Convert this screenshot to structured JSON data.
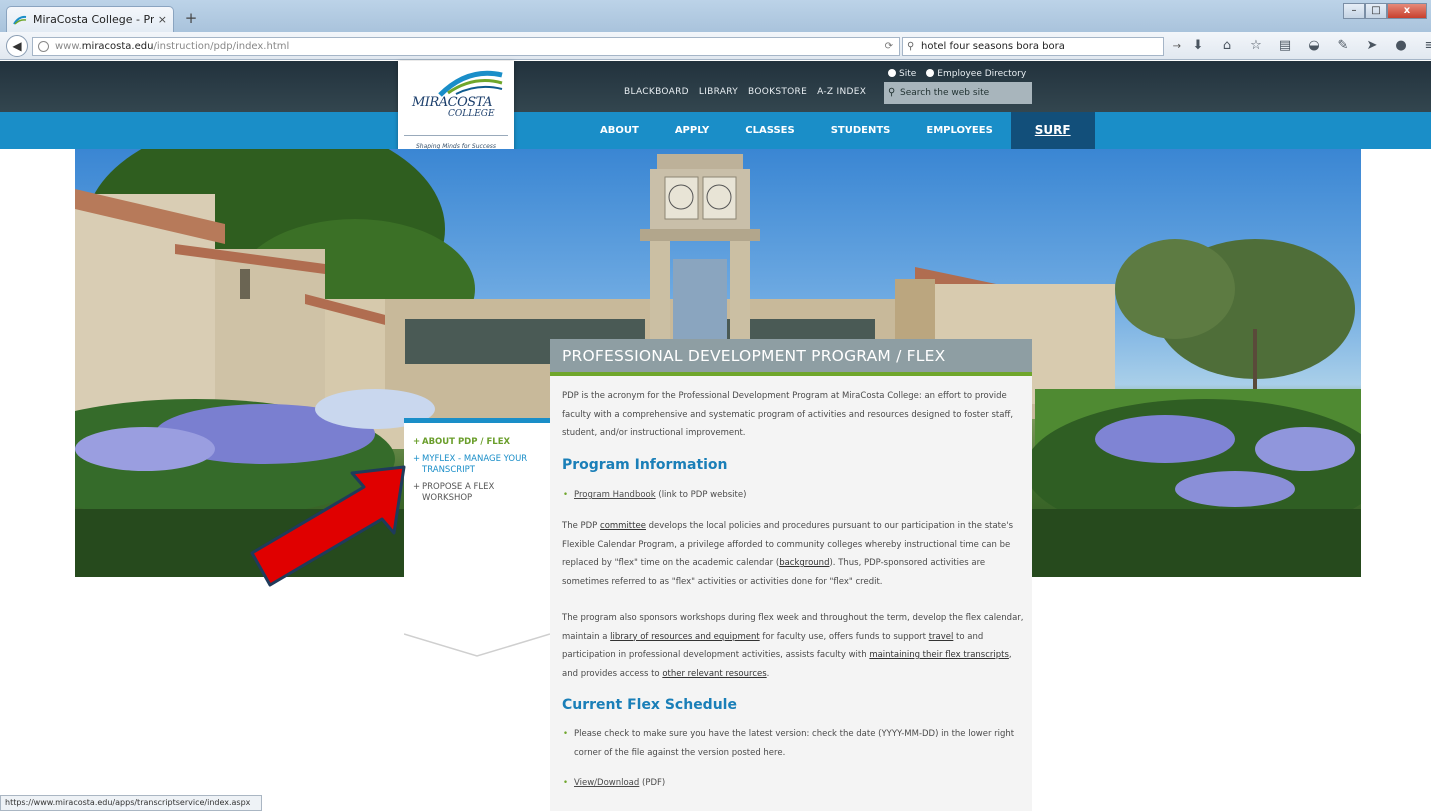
{
  "browser": {
    "tab_title": "MiraCosta College - Profes...",
    "tab_close": "×",
    "new_tab": "+",
    "url_prefix": "www.",
    "url_domain": "miracosta.edu",
    "url_path": "/instruction/pdp/index.html",
    "search_value": "hotel four seasons bora bora",
    "status_url": "https://www.miracosta.edu/apps/transcriptservice/index.aspx",
    "accent_color": "#1a8ec8"
  },
  "site": {
    "logo_name": "MIRACOSTA",
    "logo_sub": "COLLEGE",
    "logo_tagline": "Shaping Minds for Success",
    "utility_links": [
      "BLACKBOARD",
      "LIBRARY",
      "BOOKSTORE",
      "A-Z INDEX"
    ],
    "search_options": [
      "Site",
      "Employee Directory"
    ],
    "search_placeholder": "Search the web site",
    "nav": [
      "ABOUT",
      "APPLY",
      "CLASSES",
      "STUDENTS",
      "EMPLOYEES"
    ],
    "nav_special": "SURF"
  },
  "side_menu": [
    {
      "label": "About PDP / Flex"
    },
    {
      "label": "MyFlex - Manage Your Transcript"
    },
    {
      "label": "Propose A Flex Workshop"
    }
  ],
  "content": {
    "title": "PROFESSIONAL DEVELOPMENT PROGRAM / FLEX",
    "intro": "PDP is the acronym for the Professional Development Program at MiraCosta College: an effort to provide faculty with a comprehensive and systematic program of activities and resources designed to foster staff, student, and/or instructional improvement.",
    "heading_program": "Program Information",
    "handbook_link": "Program Handbook",
    "handbook_note": " (link to PDP website)",
    "p1_a": "The PDP ",
    "p1_committee": "committee",
    "p1_b": " develops the local policies and procedures pursuant to our participation in the state's Flexible Calendar Program, a privilege afforded to community colleges whereby instructional time can be replaced by \"flex\" time on the academic calendar (",
    "p1_background": "background",
    "p1_c": "). Thus, PDP-sponsored activities are sometimes referred to as \"flex\" activities or activities done for \"flex\" credit.",
    "p2_a": "The program also sponsors workshops during flex week and throughout the term, develop the flex calendar, maintain a ",
    "p2_library": "library of resources and equipment",
    "p2_b": " for faculty use, offers funds to support ",
    "p2_travel": "travel",
    "p2_c": " to and participation in professional development activities, assists faculty with ",
    "p2_transcripts": "maintaining their flex transcripts",
    "p2_d": ", and provides access to ",
    "p2_other": "other relevant resources",
    "p2_e": ".",
    "heading_schedule": "Current Flex Schedule",
    "schedule_note": "Please check to make sure you have the latest version: check the date (YYYY-MM-DD) in the lower right corner of the file against the version posted here.",
    "download_link": "View/Download",
    "download_note": " (PDF)"
  }
}
